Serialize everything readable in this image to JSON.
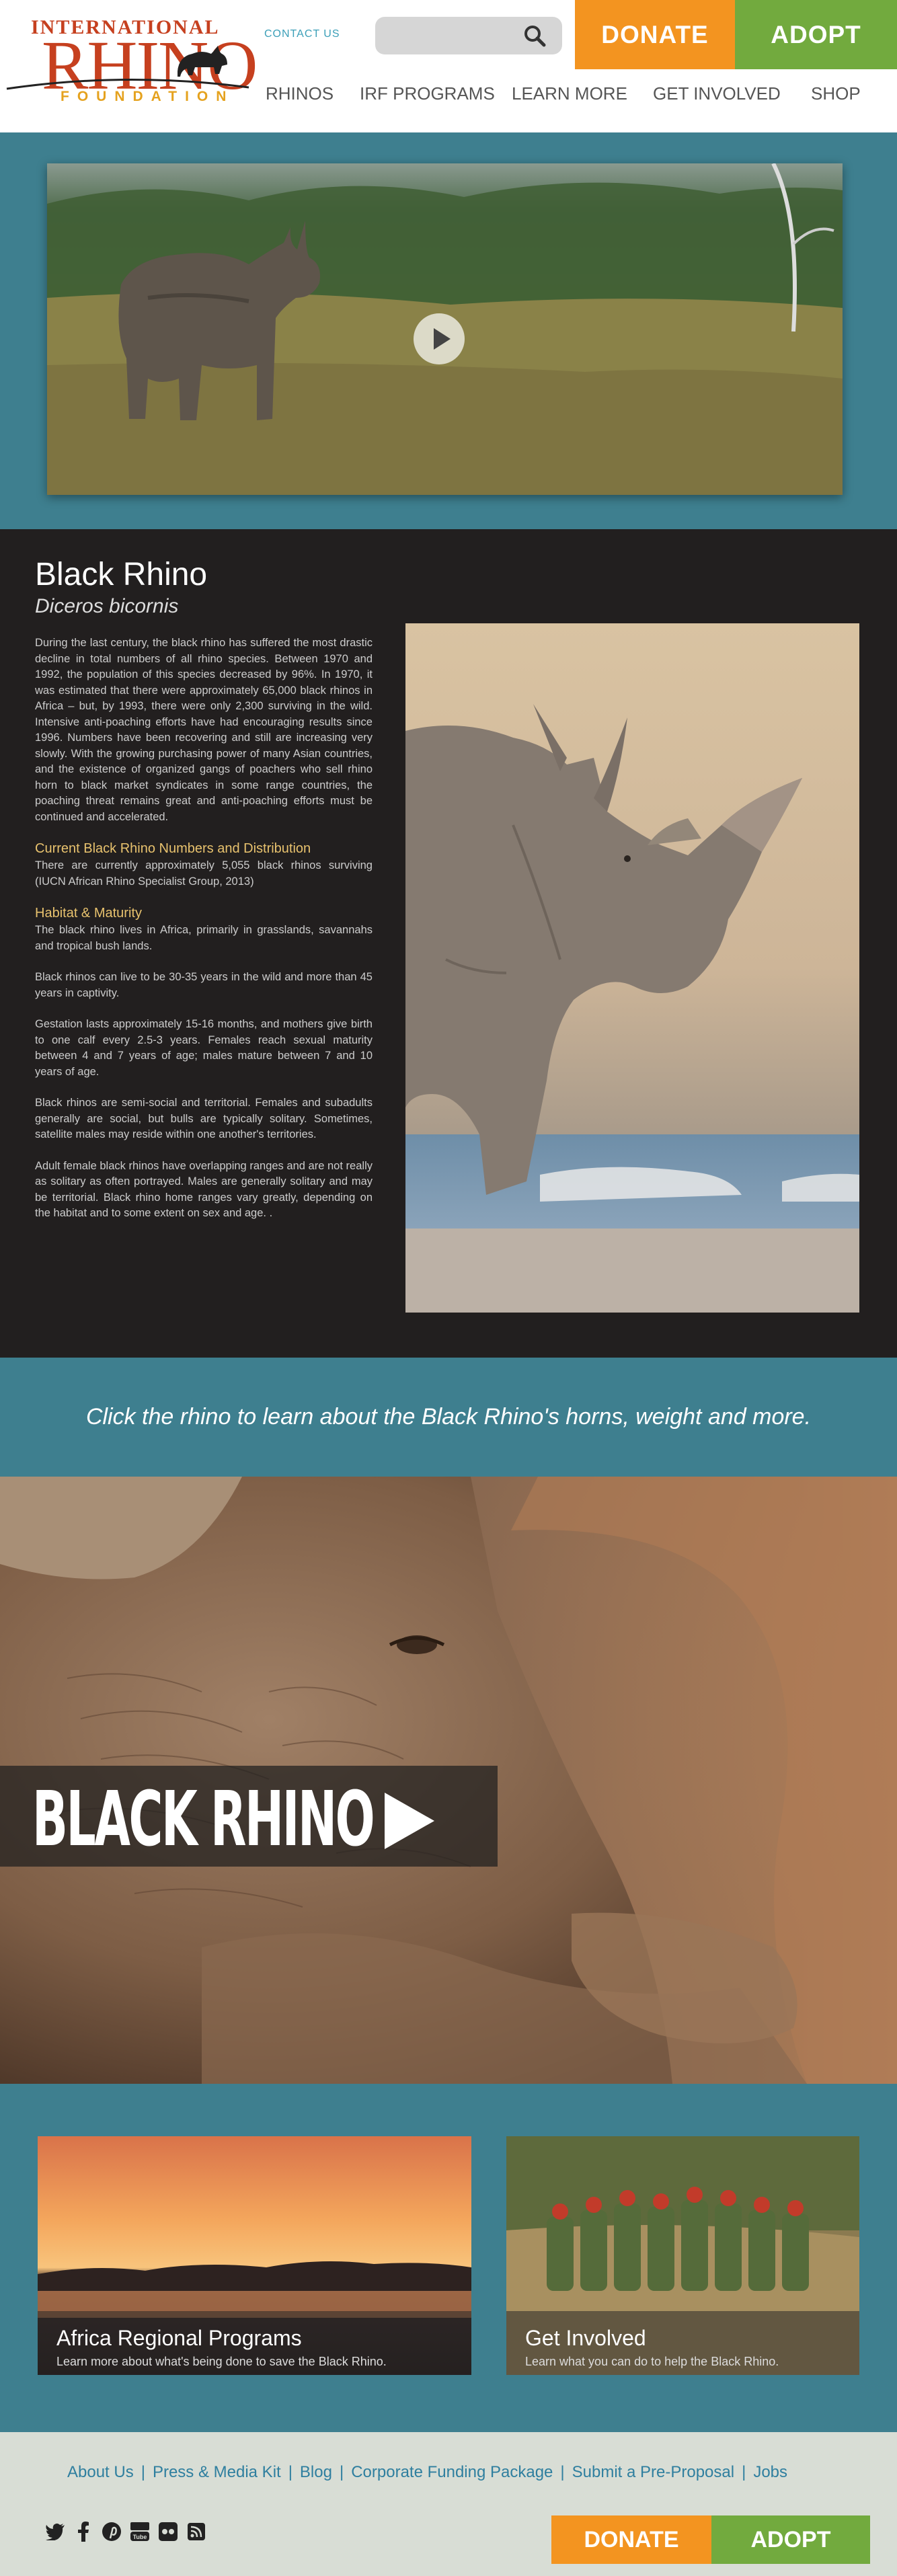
{
  "brand": {
    "top": "INTERNATIONAL",
    "main": "RHINO",
    "foundation": "FOUNDATION",
    "red": "#c6401f",
    "gold": "#e5a21e"
  },
  "header": {
    "contact_label": "CONTACT US",
    "search_placeholder": "",
    "donate_label": "DONATE",
    "adopt_label": "ADOPT",
    "nav": [
      "RHINOS",
      "IRF PROGRAMS",
      "LEARN MORE",
      "GET INVOLVED",
      "SHOP"
    ]
  },
  "colors": {
    "teal": "#3e7f8f",
    "orange": "#f39420",
    "green": "#72aa3e",
    "dark": "#221f1f",
    "heading_gold": "#e8c26e"
  },
  "species": {
    "name": "Black Rhino",
    "scientific": "Diceros bicornis",
    "intro": "During the last century, the black rhino has suffered the most drastic decline in total numbers of all rhino species. Between 1970 and 1992, the population of this species decreased by 96%. In 1970, it was estimated that there were approximately 65,000 black rhinos in Africa – but, by 1993, there were only 2,300 surviving in the wild. Intensive anti-poaching efforts have had encouraging results since 1996. Numbers have been recovering and still are increasing very slowly. With the growing purchasing power of many Asian countries, and the existence of organized gangs of poachers who sell rhino horn to black market syndicates in some range countries, the poaching threat remains great and anti-poaching efforts must be continued and accelerated.",
    "numbers_heading": "Current Black Rhino Numbers and Distribution",
    "numbers_text": "There are currently approximately 5,055 black rhinos surviving (IUCN African Rhino Specialist Group, 2013)",
    "habitat_heading": "Habitat & Maturity",
    "habitat_text": "The black rhino lives in Africa, primarily in grasslands, savannahs and tropical bush lands.",
    "lifespan_text": "Black rhinos can live to be 30-35 years in the wild and more than 45 years in captivity.",
    "gestation_text": "Gestation lasts approximately 15-16 months, and mothers give birth to one calf every 2.5-3 years. Females reach sexual maturity between 4 and 7 years of age; males mature between 7 and 10 years of age.",
    "social_text": "Black rhinos are semi-social and territorial. Females and subadults generally are social, but bulls are typically solitary. Sometimes, satellite males may reside within one another's territories.",
    "range_text": "Adult female black rhinos have overlapping ranges and are not really as solitary as often portrayed. Males are generally solitary and may be territorial. Black rhino home ranges vary greatly, depending on the habitat and to some extent on sex and age. ."
  },
  "callout": {
    "text": "Click the rhino to learn about the Black Rhino's horns, weight and more."
  },
  "hero": {
    "title": "BLACK RHINO"
  },
  "cards": [
    {
      "title": "Africa Regional Programs",
      "subtitle": "Learn more about what's being done to save the Black Rhino."
    },
    {
      "title": "Get Involved",
      "subtitle": "Learn what you can do to help the Black Rhino."
    }
  ],
  "footer": {
    "links": [
      "About Us",
      "Press & Media Kit",
      "Blog",
      "Corporate Funding Package",
      "Submit a Pre-Proposal",
      "Jobs"
    ],
    "separator": "|",
    "social_icons": [
      "twitter-icon",
      "facebook-icon",
      "pinterest-icon",
      "youtube-icon",
      "flickr-icon",
      "rss-icon"
    ],
    "donate_label": "DONATE",
    "adopt_label": "ADOPT"
  }
}
